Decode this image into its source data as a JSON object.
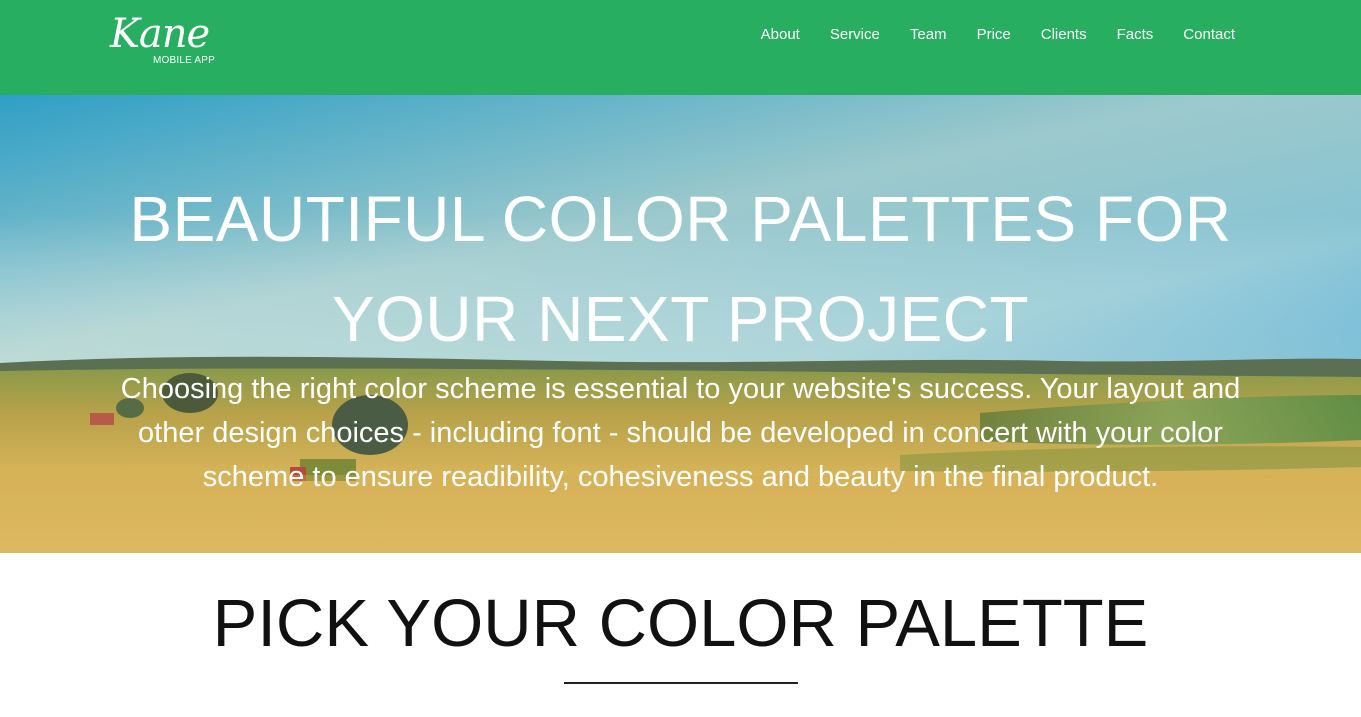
{
  "header": {
    "brand": {
      "name": "Kane",
      "tagline": "MOBILE APP"
    },
    "nav": [
      {
        "label": "About"
      },
      {
        "label": "Service"
      },
      {
        "label": "Team"
      },
      {
        "label": "Price"
      },
      {
        "label": "Clients"
      },
      {
        "label": "Facts"
      },
      {
        "label": "Contact"
      }
    ],
    "background_color": "#27ae60"
  },
  "hero": {
    "title_line1": "BEAUTIFUL COLOR PALETTES FOR",
    "title_line2": "YOUR NEXT PROJECT",
    "text_line1": "Choosing the right color scheme is essential to your website's success. Your layout and",
    "text_line2": "other design choices - including font - should be developed in concert with your color",
    "text_line3": "scheme to ensure readibility, cohesiveness and beauty in the final product."
  },
  "section": {
    "title": "PICK YOUR COLOR PALETTE"
  }
}
